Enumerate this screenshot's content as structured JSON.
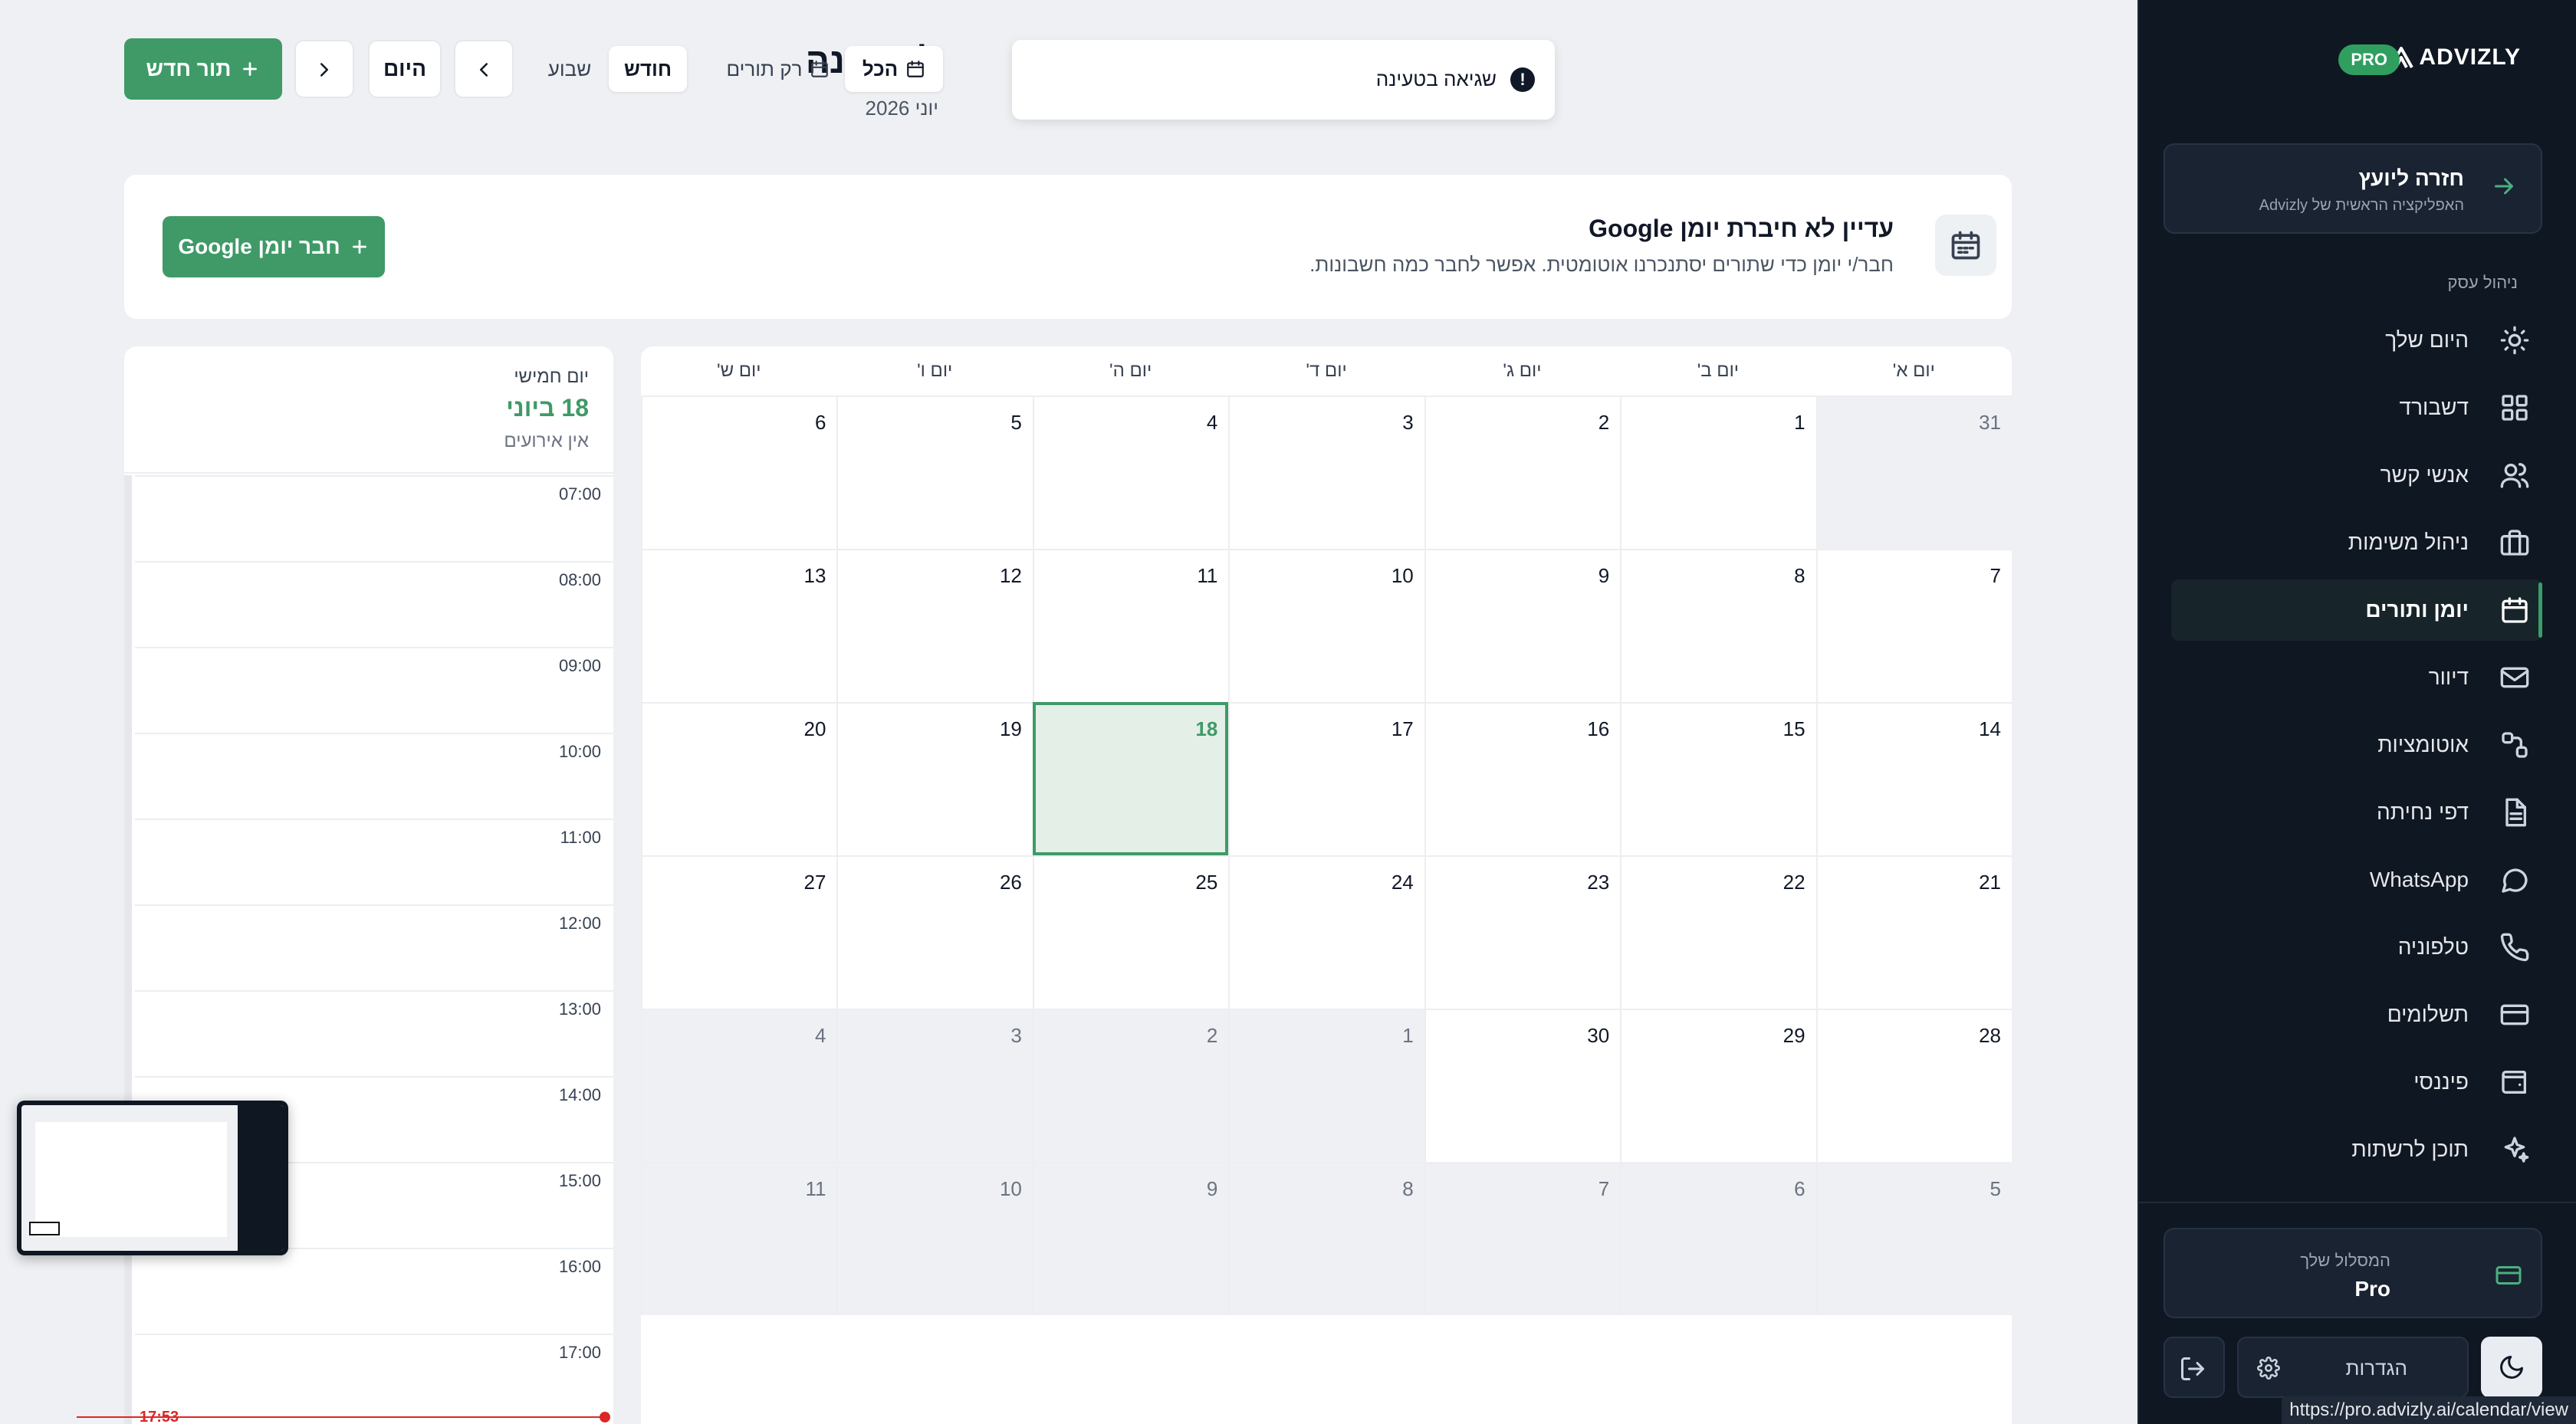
{
  "sidebar": {
    "brand": "ADVIZLY",
    "badge": "PRO",
    "back_card": {
      "title": "חזרה ליועץ",
      "subtitle": "האפליקציה הראשית של Advizly"
    },
    "section_label": "ניהול עסק",
    "items": [
      {
        "label": "היום שלך",
        "icon": "sun-icon"
      },
      {
        "label": "דשבורד",
        "icon": "dashboard-grid-icon"
      },
      {
        "label": "אנשי קשר",
        "icon": "contacts-icon"
      },
      {
        "label": "ניהול משימות",
        "icon": "briefcase-icon"
      },
      {
        "label": "יומן ותורים",
        "icon": "calendar-icon",
        "active": true
      },
      {
        "label": "דיוור",
        "icon": "mail-icon"
      },
      {
        "label": "אוטומציות",
        "icon": "automation-icon"
      },
      {
        "label": "דפי נחיתה",
        "icon": "document-icon"
      },
      {
        "label": "WhatsApp",
        "icon": "chat-bubble-icon"
      },
      {
        "label": "טלפוניה",
        "icon": "phone-icon"
      },
      {
        "label": "תשלומים",
        "icon": "credit-card-icon"
      },
      {
        "label": "פיננסי",
        "icon": "wallet-icon"
      },
      {
        "label": "תוכן לרשתות",
        "icon": "sparkles-icon"
      }
    ],
    "plan": {
      "label": "המסלול שלך",
      "value": "Pro"
    },
    "settings_label": "הגדרות"
  },
  "header": {
    "title": "לוח שנה",
    "subtitle": "יוני 2026",
    "toast": "שגיאה בטעינה",
    "filters": {
      "all": "הכל",
      "appointments_only": "רק תורים"
    },
    "views": {
      "month": "חודש",
      "week": "שבוע"
    },
    "today": "היום",
    "new_appointment": "תור חדש"
  },
  "banner": {
    "title": "עדיין לא חיברת יומן Google",
    "text": "חבר/י יומן כדי שתורים יסתנכרנו אוטומטית. אפשר לחבר כמה חשבונות.",
    "button": "חבר יומן Google"
  },
  "calendar": {
    "weekdays": [
      "יום א'",
      "יום ב'",
      "יום ג'",
      "יום ד'",
      "יום ה'",
      "יום ו'",
      "יום ש'"
    ],
    "weeks": [
      [
        {
          "d": "31",
          "o": true
        },
        {
          "d": "1"
        },
        {
          "d": "2"
        },
        {
          "d": "3"
        },
        {
          "d": "4"
        },
        {
          "d": "5"
        },
        {
          "d": "6"
        }
      ],
      [
        {
          "d": "7"
        },
        {
          "d": "8"
        },
        {
          "d": "9"
        },
        {
          "d": "10"
        },
        {
          "d": "11"
        },
        {
          "d": "12"
        },
        {
          "d": "13"
        }
      ],
      [
        {
          "d": "14"
        },
        {
          "d": "15"
        },
        {
          "d": "16"
        },
        {
          "d": "17"
        },
        {
          "d": "18",
          "t": true
        },
        {
          "d": "19"
        },
        {
          "d": "20"
        }
      ],
      [
        {
          "d": "21"
        },
        {
          "d": "22"
        },
        {
          "d": "23"
        },
        {
          "d": "24"
        },
        {
          "d": "25"
        },
        {
          "d": "26"
        },
        {
          "d": "27"
        }
      ],
      [
        {
          "d": "28"
        },
        {
          "d": "29"
        },
        {
          "d": "30"
        },
        {
          "d": "1",
          "o": true
        },
        {
          "d": "2",
          "o": true
        },
        {
          "d": "3",
          "o": true
        },
        {
          "d": "4",
          "o": true
        }
      ],
      [
        {
          "d": "5",
          "o": true
        },
        {
          "d": "6",
          "o": true
        },
        {
          "d": "7",
          "o": true
        },
        {
          "d": "8",
          "o": true
        },
        {
          "d": "9",
          "o": true
        },
        {
          "d": "10",
          "o": true
        },
        {
          "d": "11",
          "o": true
        }
      ]
    ]
  },
  "day_panel": {
    "weekday": "יום חמישי",
    "date": "18 ביוני",
    "empty": "אין אירועים",
    "hours": [
      "07:00",
      "08:00",
      "09:00",
      "10:00",
      "11:00",
      "12:00",
      "13:00",
      "14:00",
      "15:00",
      "16:00",
      "17:00"
    ],
    "now": "17:53"
  },
  "status_url": "https://pro.advizly.ai/calendar/view",
  "colors": {
    "accent": "#3f9a67",
    "sidebar_bg": "#0f1722",
    "page_bg": "#eef0f3",
    "now_line": "#dc2626"
  }
}
